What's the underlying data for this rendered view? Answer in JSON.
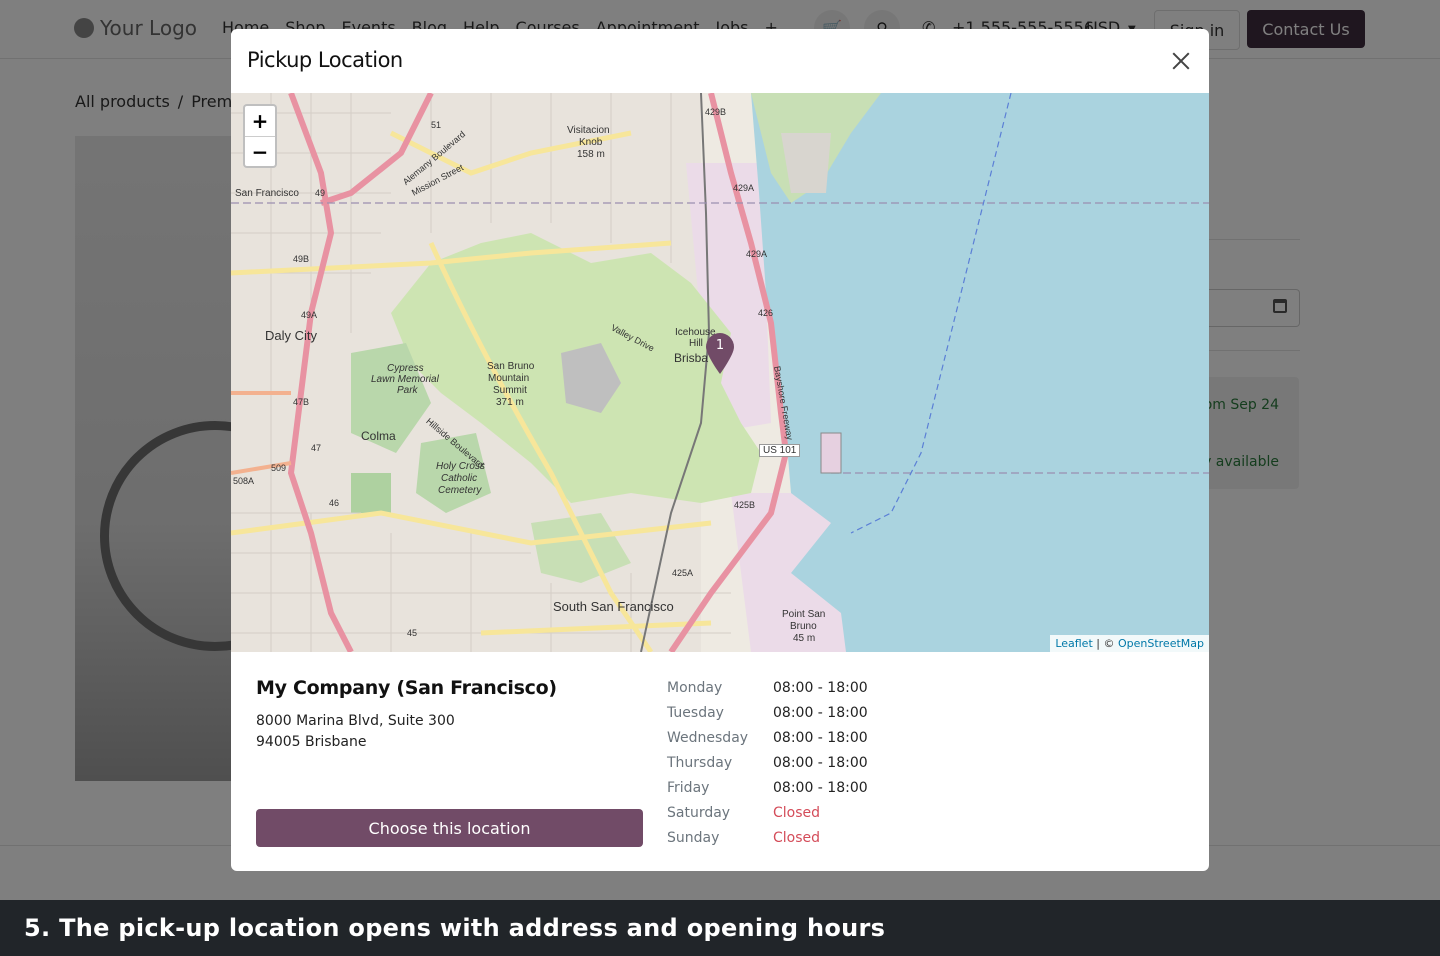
{
  "site": {
    "logo_text": "Your Logo",
    "nav": [
      "Home",
      "Shop",
      "Events",
      "Blog",
      "Help",
      "Courses",
      "Appointment",
      "Jobs",
      "+"
    ],
    "phone": "+1 555-555-5556",
    "currency": "USD",
    "sign_in": "Sign in",
    "contact": "Contact Us",
    "breadcrumb": {
      "all_products": "All products",
      "separator": "/",
      "current": "Premi"
    },
    "availability_line1": "om Sep 24",
    "availability_line2": "y available"
  },
  "modal": {
    "title": "Pickup Location",
    "map": {
      "zoom_in": "+",
      "zoom_out": "−",
      "attribution_leaflet": "Leaflet",
      "attribution_sep": " | © ",
      "attribution_osm": "OpenStreetMap",
      "marker_label": "1",
      "place_labels": {
        "daly_city": "Daly City",
        "colma": "Colma",
        "south_sf": "South San Francisco",
        "brisbane": "Brisba",
        "icehouse_1": "Icehouse",
        "icehouse_2": "Hill",
        "visitacion_1": "Visitacion",
        "visitacion_2": "Knob",
        "visitacion_3": "158 m",
        "san_bruno_1": "San Bruno",
        "san_bruno_2": "Mountain",
        "san_bruno_3": "Summit",
        "san_bruno_4": "371 m",
        "cypress_1": "Cypress",
        "cypress_2": "Lawn Memorial",
        "cypress_3": "Park",
        "holy_1": "Holy Cross",
        "holy_2": "Catholic",
        "holy_3": "Cemetery",
        "point_1": "Point San",
        "point_2": "Bruno",
        "point_3": "45 m",
        "us101": "US 101",
        "san_francisco": "San Francisco",
        "valley_drive": "Valley Drive",
        "bayshore": "Bayshore Freeway",
        "hillside": "Hillside Boulevard",
        "mission": "Mission Street",
        "alemany": "Alemany Boulevard",
        "r429b": "429B",
        "r429a": "429A",
        "r429a_2": "429A",
        "r426": "426",
        "r425b": "425B",
        "r425a": "425A",
        "r49b": "49B",
        "r49a": "49A",
        "r47b": "47B",
        "r47": "47",
        "r46": "46",
        "r509": "509",
        "r508a": "508A",
        "r45": "45",
        "r49": "49",
        "r51": "51"
      }
    },
    "location": {
      "name": "My Company (San Francisco)",
      "street": "8000 Marina Blvd, Suite 300",
      "city": "94005 Brisbane",
      "choose_button": "Choose this location"
    },
    "hours": [
      {
        "day": "Monday",
        "time": "08:00 - 18:00",
        "closed": false
      },
      {
        "day": "Tuesday",
        "time": "08:00 - 18:00",
        "closed": false
      },
      {
        "day": "Wednesday",
        "time": "08:00 - 18:00",
        "closed": false
      },
      {
        "day": "Thursday",
        "time": "08:00 - 18:00",
        "closed": false
      },
      {
        "day": "Friday",
        "time": "08:00 - 18:00",
        "closed": false
      },
      {
        "day": "Saturday",
        "time": "Closed",
        "closed": true
      },
      {
        "day": "Sunday",
        "time": "Closed",
        "closed": true
      }
    ]
  },
  "caption": "5. The pick-up location opens with address and opening hours",
  "colors": {
    "brand": "#714b67",
    "contact_button": "#3e2c3f",
    "closed": "#d44c59",
    "water": "#aad3df",
    "park": "#cde4b2",
    "caption_bg": "#212529"
  }
}
